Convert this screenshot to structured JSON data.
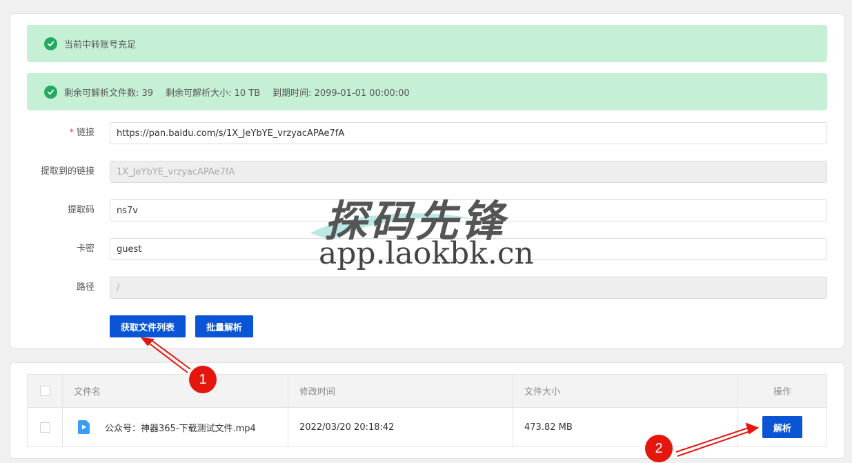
{
  "alerts": {
    "account": "当前中转账号充足",
    "files_left": "剩余可解析文件数: 39",
    "size_left": "剩余可解析大小: 10 TB",
    "expire": "到期时间: 2099-01-01 00:00:00"
  },
  "form": {
    "link": {
      "required_mark": "*",
      "label": "链接",
      "value": "https://pan.baidu.com/s/1X_JeYbYE_vrzyacAPAe7fA"
    },
    "extracted": {
      "label": "提取到的链接",
      "value": "1X_JeYbYE_vrzyacAPAe7fA"
    },
    "code": {
      "label": "提取码",
      "value": "ns7v"
    },
    "card": {
      "label": "卡密",
      "value": "guest"
    },
    "path": {
      "label": "路径",
      "value": "/"
    },
    "get_list_button": "获取文件列表",
    "batch_button": "批量解析"
  },
  "table": {
    "headers": {
      "name": "文件名",
      "time": "修改时间",
      "size": "文件大小",
      "op": "操作"
    },
    "rows": [
      {
        "name": "公众号：神器365-下载测试文件.mp4",
        "time": "2022/03/20 20:18:42",
        "size": "473.82 MB",
        "op": "解析"
      }
    ]
  },
  "watermark": {
    "title": "探码先锋",
    "url": "app.laokbk.cn"
  },
  "annotations": {
    "badge1": "1",
    "badge2": "2"
  },
  "colors": {
    "primary": "#0a55d6",
    "success_bg": "#c6f0d6",
    "success_icon": "#24a960",
    "annotation": "#e4160e"
  },
  "icons": {
    "success": "check-circle-icon",
    "file": "video-file-icon"
  }
}
